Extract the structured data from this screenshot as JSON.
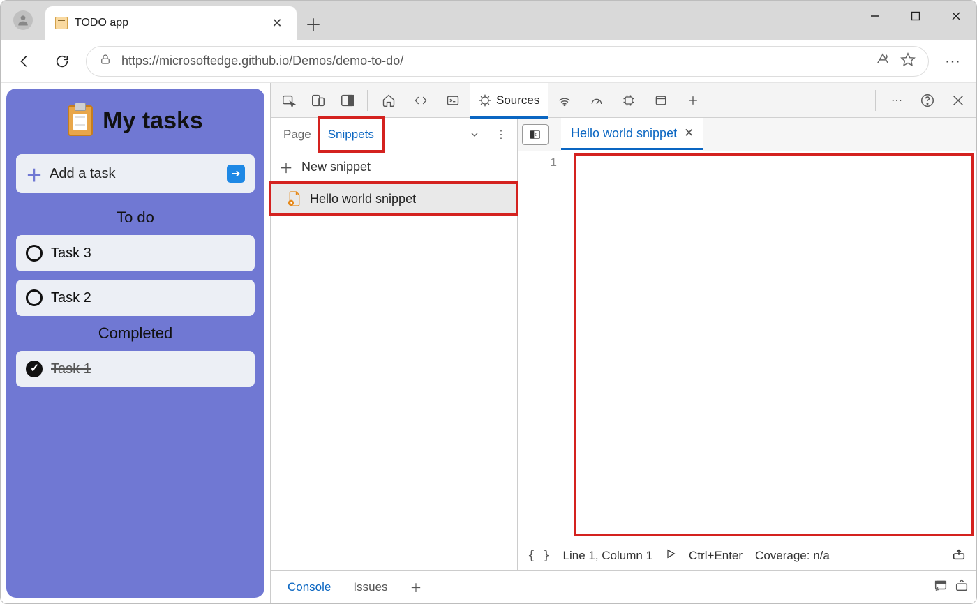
{
  "browser": {
    "tab_title": "TODO app",
    "url": "https://microsoftedge.github.io/Demos/demo-to-do/"
  },
  "app": {
    "title": "My tasks",
    "add_task_label": "Add a task",
    "sections": {
      "todo": "To do",
      "completed": "Completed"
    },
    "tasks_todo": [
      {
        "name": "Task 3"
      },
      {
        "name": "Task 2"
      }
    ],
    "tasks_done": [
      {
        "name": "Task 1"
      }
    ]
  },
  "devtools": {
    "active_panel": "Sources",
    "sources": {
      "subtabs": {
        "page": "Page",
        "snippets": "Snippets"
      },
      "new_snippet": "New snippet",
      "snippet_name": "Hello world snippet",
      "editor_tab": "Hello world snippet",
      "gutter_line": "1",
      "status": {
        "position": "Line 1, Column 1",
        "run_hint": "Ctrl+Enter",
        "coverage": "Coverage: n/a"
      }
    },
    "drawer": {
      "console": "Console",
      "issues": "Issues"
    }
  }
}
